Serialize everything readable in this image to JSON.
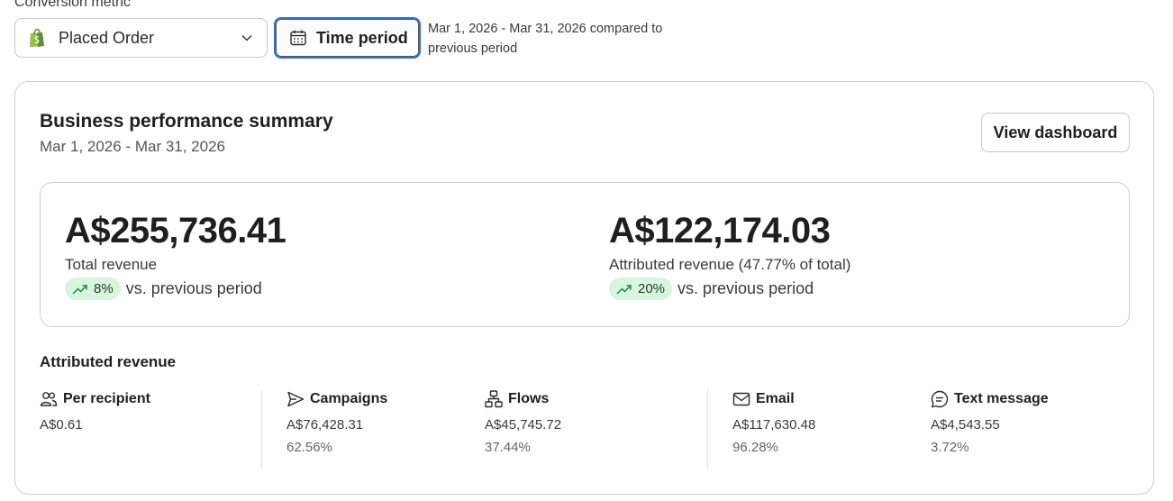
{
  "conversion_metric": {
    "label": "Conversion metric",
    "selected": "Placed Order"
  },
  "time_period": {
    "button_label": "Time period",
    "note": "Mar 1, 2026 - Mar 31, 2026 compared to previous period"
  },
  "summary": {
    "title": "Business performance summary",
    "date_range": "Mar 1, 2026 - Mar 31, 2026",
    "view_dashboard_label": "View dashboard",
    "total_revenue": {
      "amount": "A$255,736.41",
      "label": "Total revenue",
      "change": "8%",
      "vs_text": "vs. previous period"
    },
    "attributed_revenue": {
      "amount": "A$122,174.03",
      "label": "Attributed revenue (47.77% of total)",
      "change": "20%",
      "vs_text": "vs. previous period"
    }
  },
  "attributed": {
    "title": "Attributed revenue",
    "stats": [
      {
        "label": "Per recipient",
        "icon": "people-icon",
        "value": "A$0.61",
        "percent": ""
      },
      {
        "label": "Campaigns",
        "icon": "send-icon",
        "value": "A$76,428.31",
        "percent": "62.56%"
      },
      {
        "label": "Flows",
        "icon": "flow-icon",
        "value": "A$45,745.72",
        "percent": "37.44%"
      },
      {
        "label": "Email",
        "icon": "mail-icon",
        "value": "A$117,630.48",
        "percent": "96.28%"
      },
      {
        "label": "Text message",
        "icon": "message-icon",
        "value": "A$4,543.55",
        "percent": "3.72%"
      }
    ]
  },
  "colors": {
    "accent": "#2f6fd6",
    "positive_pill": "#d8f5df",
    "positive_icon": "#1c8a3a",
    "shopify_green": "#5e8e3e"
  }
}
